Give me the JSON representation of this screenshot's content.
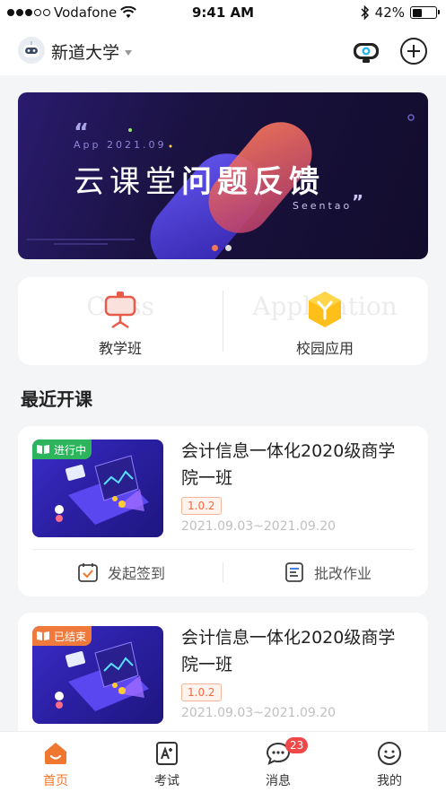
{
  "status_bar": {
    "carrier": "Vodafone",
    "time": "9:41 AM",
    "battery": "42%"
  },
  "header": {
    "school_name": "新道大学"
  },
  "banner": {
    "small_text": "App 2021.09",
    "title_light": "云课堂",
    "title_bold": "问题反馈",
    "english": "Seentao",
    "page_count": 2,
    "active_page": 1
  },
  "quick_entries": [
    {
      "label": "教学班",
      "ghost": "Class",
      "icon": "presentation-icon"
    },
    {
      "label": "校园应用",
      "ghost": "Application",
      "icon": "app-cube-icon"
    }
  ],
  "section": {
    "title": "最近开课"
  },
  "courses": [
    {
      "status": "进行中",
      "status_color": "#2db55d",
      "name": "会计信息一体化2020级商学院一班",
      "version": "1.0.2",
      "date_range": "2021.09.03~2021.09.20"
    },
    {
      "status": "已结束",
      "status_color": "#f07a3c",
      "name": "会计信息一体化2020级商学院一班",
      "version": "1.0.2",
      "date_range": "2021.09.03~2021.09.20"
    }
  ],
  "course_actions": {
    "checkin": "发起签到",
    "grade": "批改作业"
  },
  "tabbar": {
    "items": [
      {
        "label": "首页",
        "icon": "home-icon",
        "active": true
      },
      {
        "label": "考试",
        "icon": "exam-icon",
        "active": false
      },
      {
        "label": "消息",
        "icon": "message-icon",
        "active": false,
        "badge": "23"
      },
      {
        "label": "我的",
        "icon": "profile-icon",
        "active": false
      }
    ]
  },
  "colors": {
    "accent": "#f0772f",
    "badge": "#f04848",
    "banner_bg": "#1a1240"
  }
}
